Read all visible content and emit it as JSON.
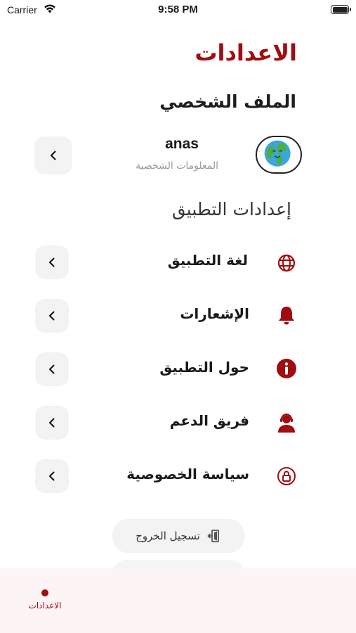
{
  "status_bar": {
    "carrier": "Carrier",
    "time": "9:58 PM"
  },
  "header": {
    "title": "الاعدادات"
  },
  "profile": {
    "heading": "الملف الشخصي",
    "name": "anas",
    "subtitle": "المعلومات الشخصية"
  },
  "app_settings": {
    "heading": "إعدادات التطبيق",
    "items": [
      {
        "label": "لغة التطبيق",
        "icon": "globe-icon"
      },
      {
        "label": "الإشعارات",
        "icon": "bell-icon"
      },
      {
        "label": "حول التطبيق",
        "icon": "info-icon"
      },
      {
        "label": "فريق الدعم",
        "icon": "support-agent-icon"
      },
      {
        "label": "سياسة الخصوصية",
        "icon": "lock-icon"
      }
    ]
  },
  "logout": {
    "label": "تسجيل الخروج",
    "icon": "logout-icon"
  },
  "bottom_nav": {
    "items": [
      {
        "label": "الاعدادات"
      }
    ]
  },
  "colors": {
    "accent": "#a00d11",
    "button_bg": "#f3f3f3",
    "nav_bg": "#fdf4f6"
  }
}
